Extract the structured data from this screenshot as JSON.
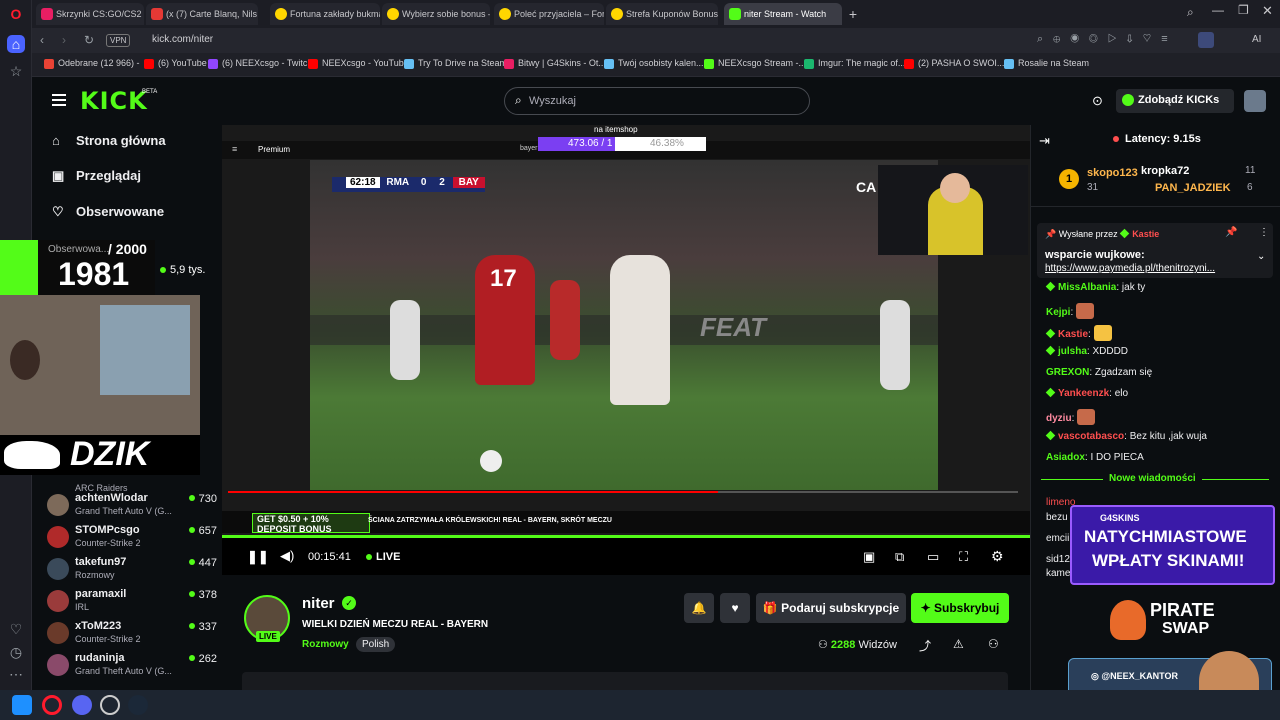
{
  "browser": {
    "tabs": [
      {
        "label": "Skrzynki CS:GO/CS2 | G4S",
        "color": "#e91e63"
      },
      {
        "label": "(x (7) Carte Blanq, Nils va",
        "color": "#e53935"
      },
      {
        "label": "Fortuna zakłady bukmach",
        "color": "#ffd600"
      },
      {
        "label": "Wybierz sobie bonus – Fo",
        "color": "#ffd600"
      },
      {
        "label": "Poleć przyjaciela – Fortuna",
        "color": "#ffd600"
      },
      {
        "label": "Strefa Kuponów Bonus | F",
        "color": "#ffd600"
      },
      {
        "label": "niter Stream - Watch",
        "color": "#53fc18"
      }
    ],
    "new_tab": "+",
    "vpn": "VPN",
    "url": "kick.com/niter",
    "ai_label": "AI",
    "bookmarks": [
      {
        "label": "Odebrane (12 966) -",
        "color": "#ea4335"
      },
      {
        "label": "(6) YouTube",
        "color": "#ff0000"
      },
      {
        "label": "(6) NEEXcsgo - Twitch",
        "color": "#9146ff"
      },
      {
        "label": "NEEXcsgo - YouTube",
        "color": "#ff0000"
      },
      {
        "label": "Try To Drive na Steam",
        "color": "#66c0f4"
      },
      {
        "label": "Bitwy | G4Skins - Ot...",
        "color": "#e91e63"
      },
      {
        "label": "Twój osobisty kalen...",
        "color": "#66c0f4"
      },
      {
        "label": "NEEXcsgo Stream -...",
        "color": "#53fc18"
      },
      {
        "label": "Imgur: The magic of...",
        "color": "#1bb76e"
      },
      {
        "label": "(2) PASHA O SWOI...",
        "color": "#ff0000"
      },
      {
        "label": "Rosalie na Steam",
        "color": "#66c0f4"
      }
    ]
  },
  "kick": {
    "logo": "KICK",
    "beta": "BETA",
    "search_placeholder": "Wyszukaj",
    "get_kicks": "Zdobądź KICKs",
    "nav": {
      "home": "Strona główna",
      "browse": "Przeglądaj",
      "following": "Obserwowane"
    },
    "followed_label": "Obserwowa...",
    "channels": [
      {
        "name": "",
        "game": "",
        "viewers": "5,9 tys."
      },
      {
        "name": "achtenWlodar",
        "game": "Grand Theft Auto V (G...",
        "viewers": "730"
      },
      {
        "name": "STOMPcsgo",
        "game": "Counter-Strike 2",
        "viewers": "657"
      },
      {
        "name": "takefun97",
        "game": "Rozmowy",
        "viewers": "447"
      },
      {
        "name": "paramaxil",
        "game": "IRL",
        "viewers": "378"
      },
      {
        "name": "xToM223",
        "game": "Counter-Strike 2",
        "viewers": "337"
      },
      {
        "name": "rudaninja",
        "game": "Grand Theft Auto V (G...",
        "viewers": "262"
      }
    ],
    "arc_raiders": "ARC Raiders"
  },
  "overlay": {
    "goal_current": "1981",
    "goal_total": "/ 2000",
    "brand": "DZIK",
    "itemshop": "na itemshop",
    "progress_text": "473.06 / 1",
    "progress_pct": "46.38%",
    "g4_line1": "NATYCHMIASTOWE",
    "g4_line2": "WPŁATY SKINAMI!",
    "g4_brand": "G4SKINS",
    "pirate": "PIRATE",
    "swap": "SWAP",
    "insta": "@NEEX_KANTOR",
    "ticker_bonus_1": "GET $0.50 + 10%",
    "ticker_bonus_2": "DEPOSIT BONUS",
    "ticker_text": "ŚCIANA ZATRZYMAŁA KRÓLEWSKICH! REAL - BAYERN, SKRÓT MECZU",
    "ca": "CA"
  },
  "video": {
    "yt_premium": "Premium",
    "search_term": "bayern",
    "scorebug": {
      "time": "62:18",
      "home": "RMA",
      "home_score": "0",
      "away_score": "2",
      "away": "BAY"
    },
    "shirt_number": "17",
    "ad_text": "FEAT"
  },
  "player": {
    "time": "00:15:41",
    "live": "LIVE"
  },
  "stream": {
    "channel": "niter",
    "title": "WIELKI DZIEŃ MECZU REAL - BAYERN",
    "category": "Rozmowy",
    "language": "Polish",
    "viewers": "2288",
    "viewers_label": "Widzów",
    "live_badge": "LIVE",
    "gift_sub": "Podaruj subskrypcje",
    "subscribe": "Subskrybuj"
  },
  "chat": {
    "latency": "Latency: 9.15s",
    "leaders": [
      {
        "rank": "1",
        "name": "skopo123",
        "count": "31"
      },
      {
        "name": "kropka72",
        "count": "11"
      },
      {
        "name": "PAN_JADZIEK",
        "count": "6"
      }
    ],
    "pinned_by": "Wysłane przez",
    "pinned_user": "Kastie",
    "pinned_text": "wsparcie wujkowe:",
    "pinned_link": "https://www.paymedia.pl/thenitrozyni...",
    "messages": [
      {
        "user": "MissAlbania",
        "text": "jak ty",
        "color": "#53fc18"
      },
      {
        "user": "Kejpi",
        "text": "",
        "color": "#53fc18"
      },
      {
        "user": "Kastie",
        "text": "",
        "color": "#ff4f4f"
      },
      {
        "user": "julsha",
        "text": "XDDDD",
        "color": "#53fc18"
      },
      {
        "user": "GREXON",
        "text": "Zgadzam się",
        "color": "#53fc18"
      },
      {
        "user": "Yankeenzk",
        "text": "elo",
        "color": "#ff4f4f"
      },
      {
        "user": "dyziu",
        "text": "",
        "color": "#ff8aa0"
      },
      {
        "user": "vascotabasco",
        "text": "Bez kitu ,jak wuja",
        "color": "#ff4f4f"
      },
      {
        "user": "Asiadox",
        "text": "I DO PIECA",
        "color": "#53fc18"
      }
    ],
    "new_messages": "Nowe wiadomości",
    "partial": [
      "limeno",
      "bezu",
      "emcii",
      "sid12",
      "kame"
    ]
  },
  "colors": {
    "kick_green": "#53fc18",
    "bg": "#0b0e11",
    "panel": "#191b1f"
  }
}
